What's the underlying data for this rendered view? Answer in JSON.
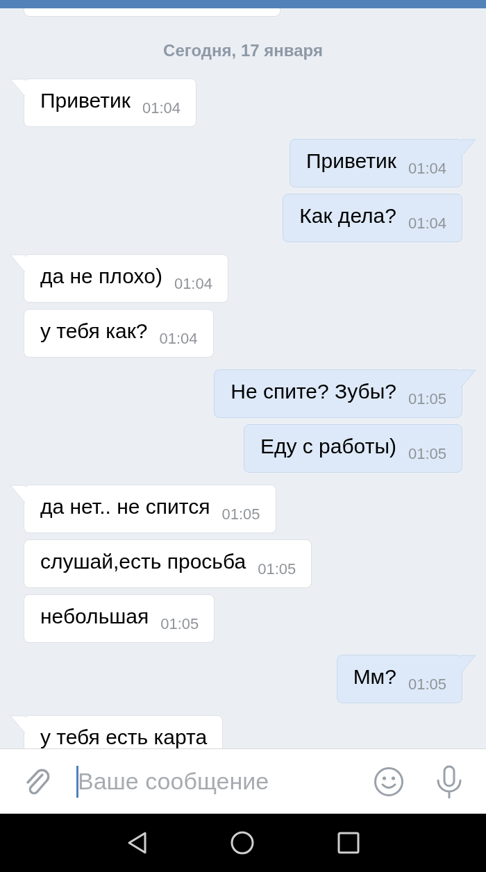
{
  "chat": [
    {
      "kind": "date",
      "text": "Сегодня, 17 января"
    },
    {
      "kind": "group",
      "outgoing": false,
      "messages": [
        {
          "text": "Приветик",
          "time": "01:04"
        }
      ]
    },
    {
      "kind": "group",
      "outgoing": true,
      "messages": [
        {
          "text": "Приветик",
          "time": "01:04"
        },
        {
          "text": "Как дела?",
          "time": "01:04"
        }
      ]
    },
    {
      "kind": "group",
      "outgoing": false,
      "messages": [
        {
          "text": "да не плохо)",
          "time": "01:04"
        },
        {
          "text": "у тебя как?",
          "time": "01:04"
        }
      ]
    },
    {
      "kind": "group",
      "outgoing": true,
      "messages": [
        {
          "text": "Не спите? Зубы?",
          "time": "01:05"
        },
        {
          "text": "Еду с работы)",
          "time": "01:05"
        }
      ]
    },
    {
      "kind": "group",
      "outgoing": false,
      "messages": [
        {
          "text": "да нет.. не спится",
          "time": "01:05"
        },
        {
          "text": "слушай,есть просьба",
          "time": "01:05"
        },
        {
          "text": "небольшая",
          "time": "01:05"
        }
      ]
    },
    {
      "kind": "group",
      "outgoing": true,
      "messages": [
        {
          "text": "Мм?",
          "time": "01:05"
        }
      ]
    },
    {
      "kind": "group",
      "outgoing": false,
      "messages": [
        {
          "text": "у тебя есть карта"
        }
      ]
    }
  ],
  "composer": {
    "placeholder": "Ваше сообщение"
  }
}
